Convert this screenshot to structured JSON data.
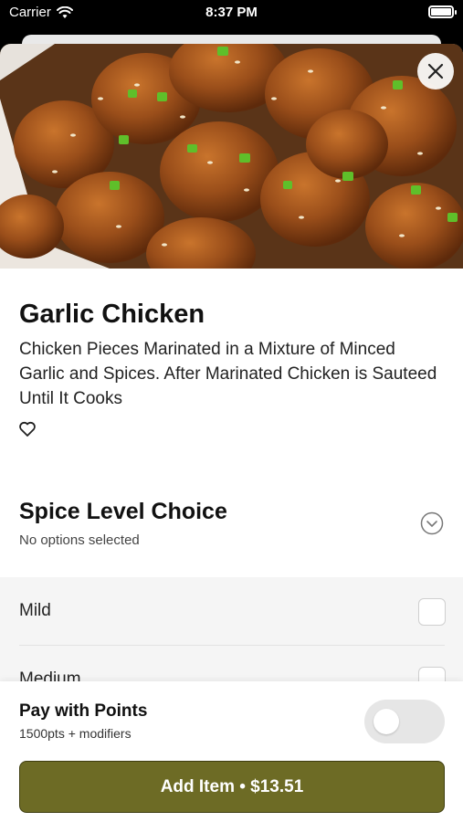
{
  "status_bar": {
    "carrier": "Carrier",
    "time": "8:37 PM",
    "wifi_icon": "wifi-icon",
    "battery_icon": "battery-icon",
    "battery_level": 1.0
  },
  "item": {
    "title": "Garlic Chicken",
    "description": "Chicken Pieces Marinated in a Mixture of Minced Garlic and Spices. After Marinated Chicken is Sauteed Until It Cooks",
    "hero_image": "sesame-garlic-chicken-photo",
    "close_icon": "close-icon",
    "favorite_icon": "heart-outline-icon"
  },
  "spice_section": {
    "title": "Spice Level Choice",
    "subtitle": "No options selected",
    "expand_icon": "chevron-down-circle-icon",
    "options": [
      {
        "label": "Mild",
        "checked": false
      },
      {
        "label": "Medium",
        "checked": false
      }
    ]
  },
  "points": {
    "title": "Pay with Points",
    "subtitle": "1500pts + modifiers",
    "toggle_on": false
  },
  "add_button": {
    "label": "Add Item • $13.51"
  },
  "colors": {
    "accent": "#6d6b25",
    "toggle_off": "#e6e6e6",
    "options_bg": "#f5f5f5"
  }
}
